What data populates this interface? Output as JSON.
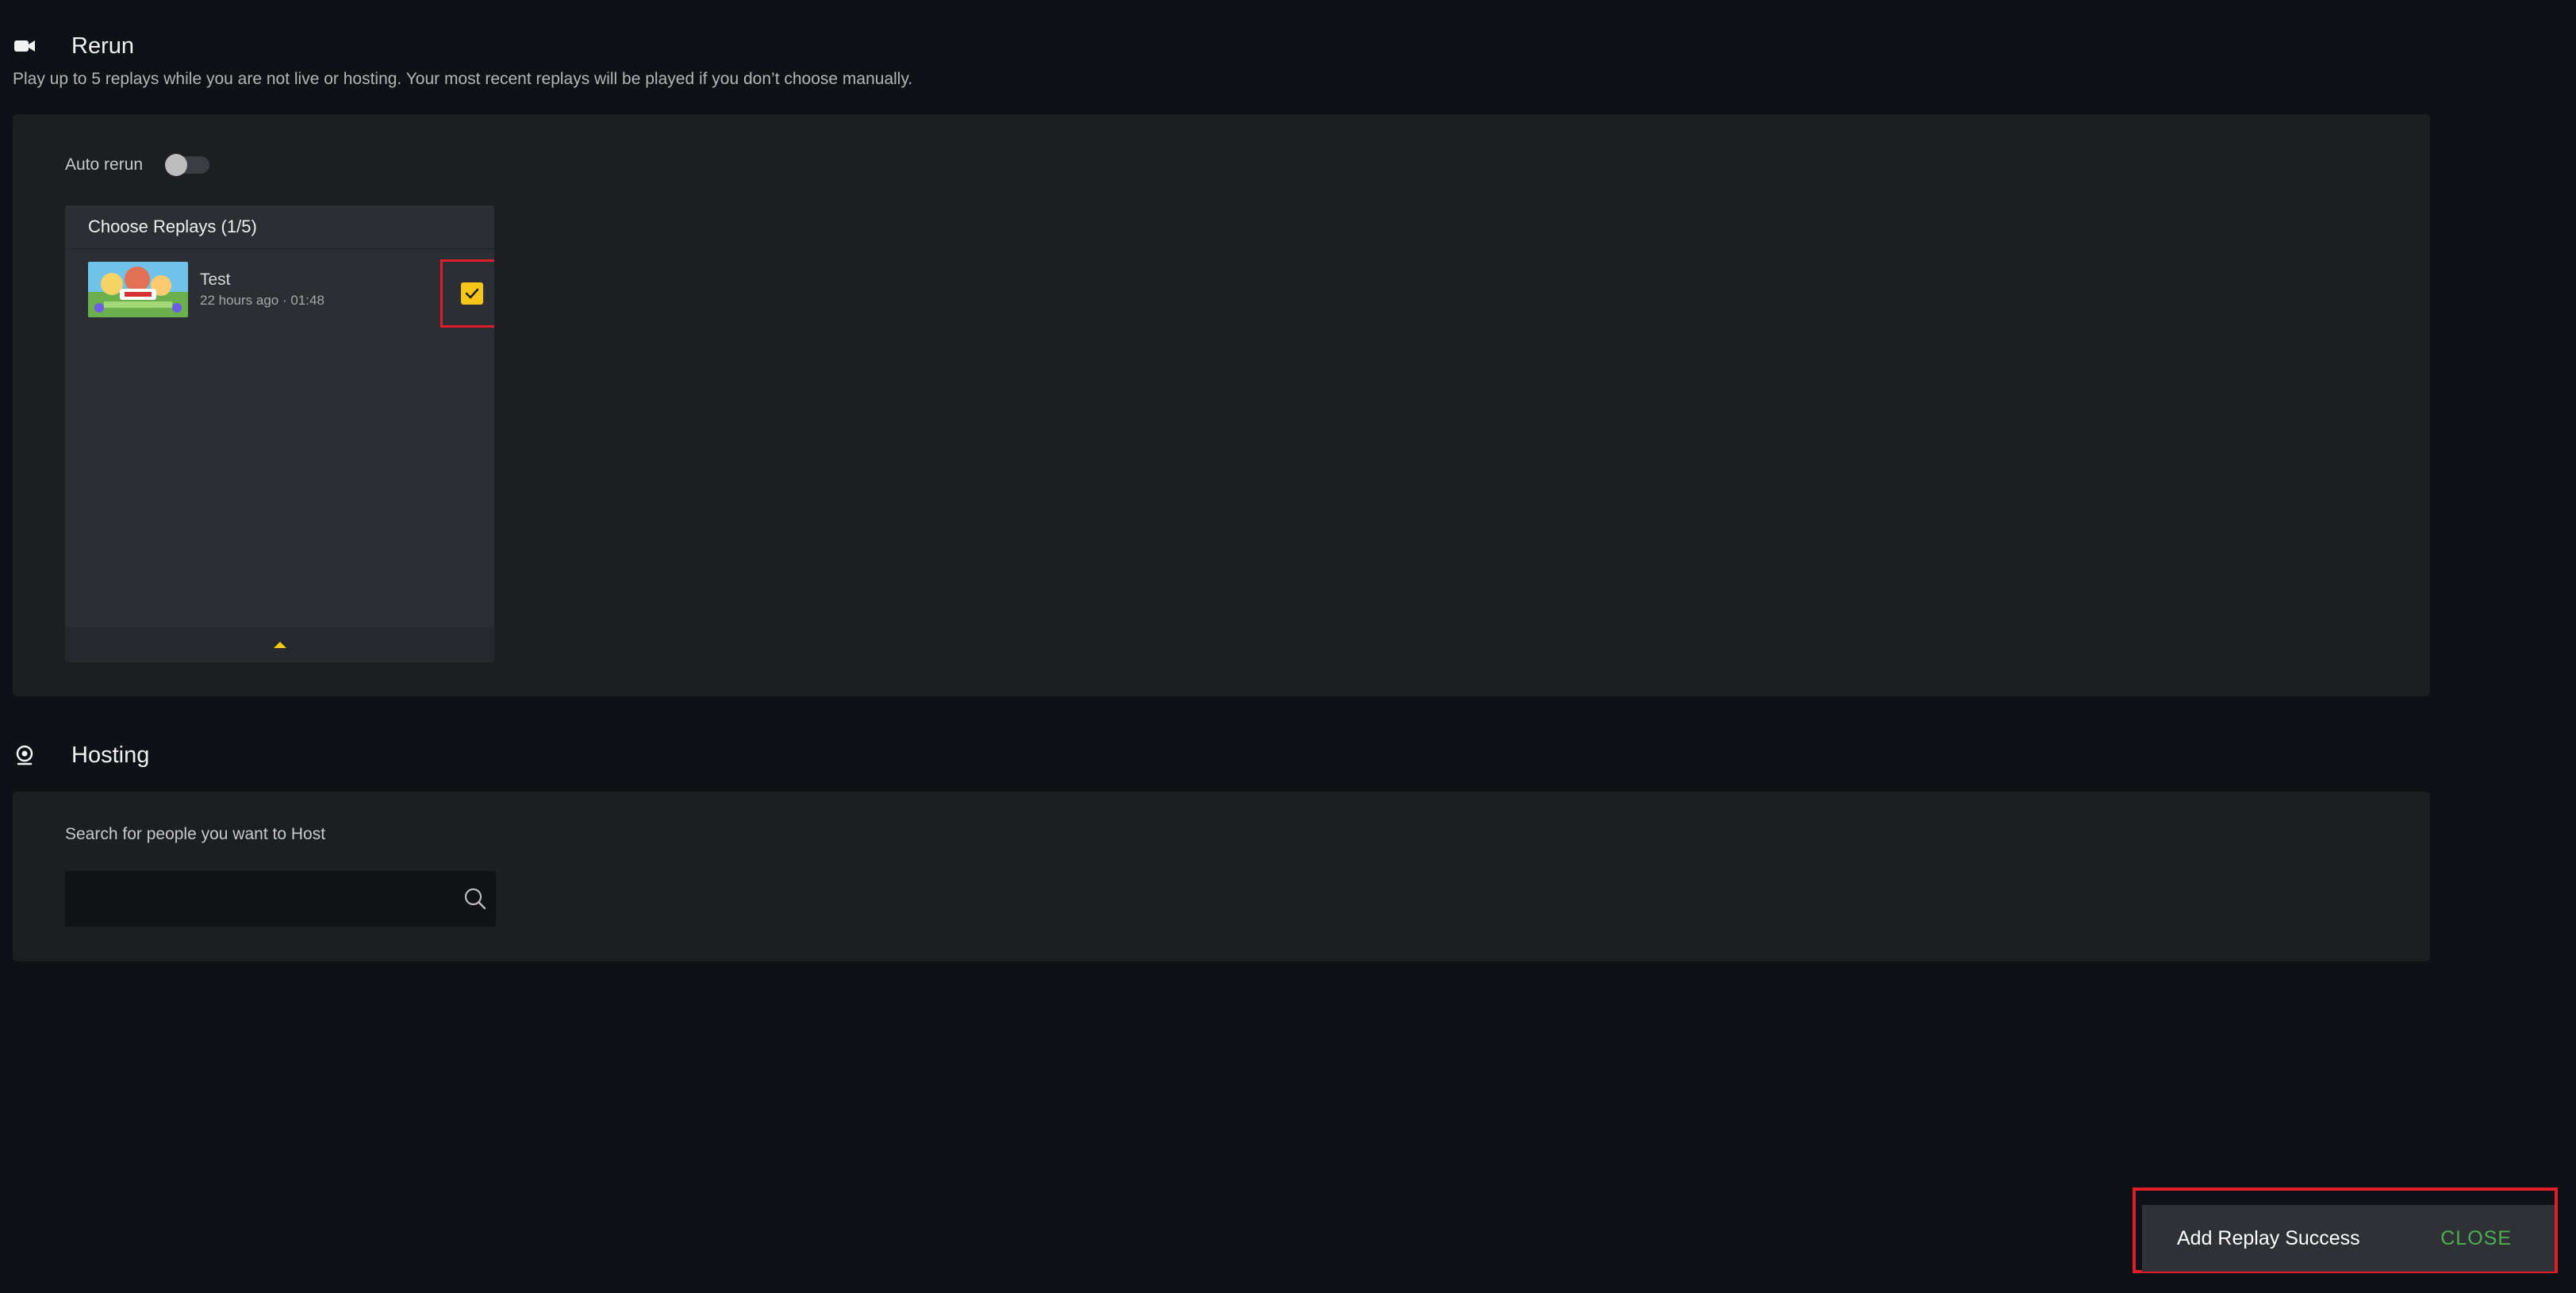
{
  "rerun": {
    "title": "Rerun",
    "icon": "video-camera-icon",
    "description": "Play up to 5 replays while you are not live or hosting. Your most recent replays will be played if you don’t choose manually.",
    "auto_rerun_label": "Auto rerun",
    "auto_rerun_enabled": false,
    "choose_replays": {
      "title": "Choose Replays (1/5)",
      "items": [
        {
          "title": "Test",
          "subtitle": "22 hours ago · 01:48",
          "checked": true
        }
      ]
    }
  },
  "hosting": {
    "title": "Hosting",
    "icon": "webcam-icon",
    "search_label": "Search for people you want to Host",
    "search_value": "",
    "search_placeholder": ""
  },
  "toast": {
    "message": "Add Replay Success",
    "close_label": "CLOSE"
  },
  "colors": {
    "background": "#0e1115",
    "panel": "#1c1e22",
    "accent": "#f5c518",
    "close": "#4caf50",
    "highlight": "#e01e2a"
  }
}
